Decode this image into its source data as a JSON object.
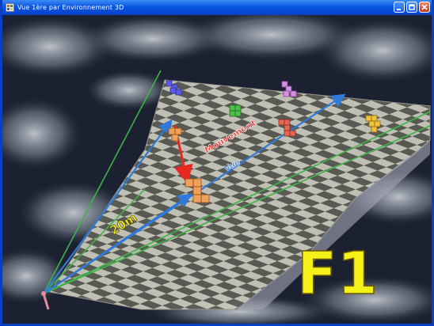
{
  "window": {
    "title": "Vue 1ère par Environnement 3D",
    "icons": {
      "app": "app-icon",
      "minimize": "minimize-icon",
      "maximize": "maximize-icon",
      "close": "close-icon"
    },
    "title_bar_color": "#0a55e0"
  },
  "scene": {
    "distance_label": "20m",
    "direction_label": "Vue",
    "move_label": "Mouvement",
    "key_label": "F1",
    "colors": {
      "grid_light": "#c8c8b8",
      "grid_dark": "#5a5a52",
      "vision_line": "#2f7ad8",
      "field_edge": "#3fb24a",
      "move_arrow": "#e8281e",
      "distance_text": "#f2e81a",
      "key_text": "#f5ef1a"
    }
  }
}
